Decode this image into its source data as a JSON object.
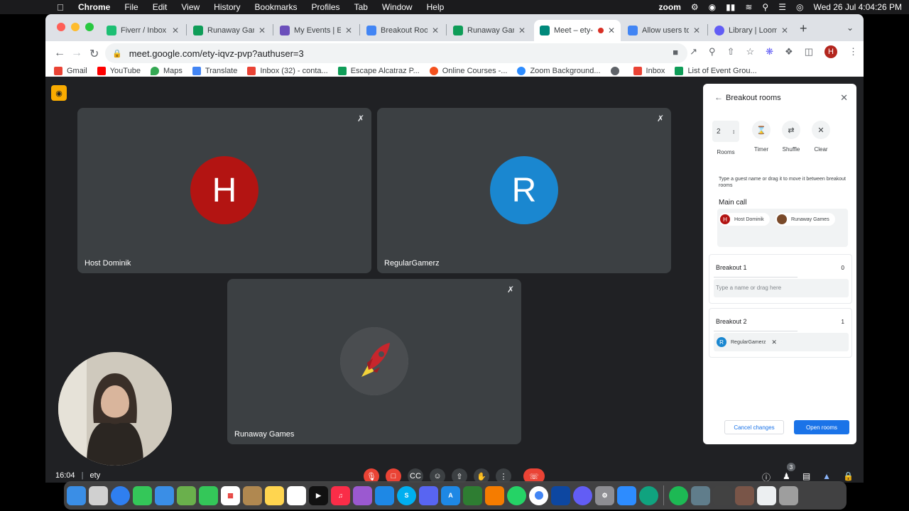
{
  "menubar": {
    "app": "Chrome",
    "items": [
      "File",
      "Edit",
      "View",
      "History",
      "Bookmarks",
      "Profiles",
      "Tab",
      "Window",
      "Help"
    ],
    "zoom_label": "zoom",
    "datetime": "Wed 26 Jul  4:04:26 PM"
  },
  "tabs": [
    {
      "label": "Fiverr / Inbox",
      "color": "#1dbf73"
    },
    {
      "label": "Runaway Game",
      "color": "#0f9d58"
    },
    {
      "label": "My Events | Ele",
      "color": "#6b4fbb"
    },
    {
      "label": "Breakout Room",
      "color": "#4285f4"
    },
    {
      "label": "Runaway Game",
      "color": "#0f9d58"
    },
    {
      "label": "Meet – ety-",
      "color": "#00897b"
    },
    {
      "label": "Allow users to j",
      "color": "#4285f4"
    },
    {
      "label": "Library | Loom",
      "color": "#625df5"
    }
  ],
  "address": {
    "url": "meet.google.com/ety-iqvz-pvp?authuser=3"
  },
  "profile_initial": "H",
  "bookmarks": [
    {
      "label": "Gmail",
      "color": "#ea4335"
    },
    {
      "label": "YouTube",
      "color": "#ff0000"
    },
    {
      "label": "Maps",
      "color": "#34a853"
    },
    {
      "label": "Translate",
      "color": "#4285f4"
    },
    {
      "label": "Inbox (32) - conta...",
      "color": "#ea4335"
    },
    {
      "label": "Escape Alcatraz P...",
      "color": "#0f9d58"
    },
    {
      "label": "Online Courses -...",
      "color": "#f4511e"
    },
    {
      "label": "Zoom Background...",
      "color": "#2d8cff"
    },
    {
      "label": "",
      "color": "#5f6368"
    },
    {
      "label": "Inbox",
      "color": "#ea4335"
    },
    {
      "label": "List of Event Grou...",
      "color": "#0f9d58"
    }
  ],
  "meet": {
    "tiles": [
      {
        "name": "Host Dominik",
        "initial": "H",
        "color": "#b31412"
      },
      {
        "name": "RegularGamerz",
        "initial": "R",
        "color": "#1a87d0"
      },
      {
        "name": "Runaway Games",
        "initial": "",
        "color": "#5f6368"
      }
    ],
    "time": "16:04",
    "meeting_code": "ety",
    "participant_count": "3"
  },
  "breakout": {
    "title": "Breakout rooms",
    "rooms_value": "2",
    "tools": [
      "Rooms",
      "Timer",
      "Shuffle",
      "Clear"
    ],
    "hint": "Type a guest name or drag it to move it between breakout rooms",
    "main_call_label": "Main call",
    "main_call_participants": [
      {
        "name": "Host Dominik",
        "initial": "H",
        "color": "#b31412"
      },
      {
        "name": "Runaway Games",
        "initial": "",
        "color": "#7a4a2a"
      }
    ],
    "rooms": [
      {
        "name": "Breakout 1",
        "count": "0",
        "placeholder": "Type a name or drag here",
        "participants": []
      },
      {
        "name": "Breakout 2",
        "count": "1",
        "participants": [
          {
            "name": "RegularGamerz",
            "initial": "R",
            "color": "#1a87d0"
          }
        ]
      }
    ],
    "cancel_label": "Cancel changes",
    "open_label": "Open rooms"
  }
}
